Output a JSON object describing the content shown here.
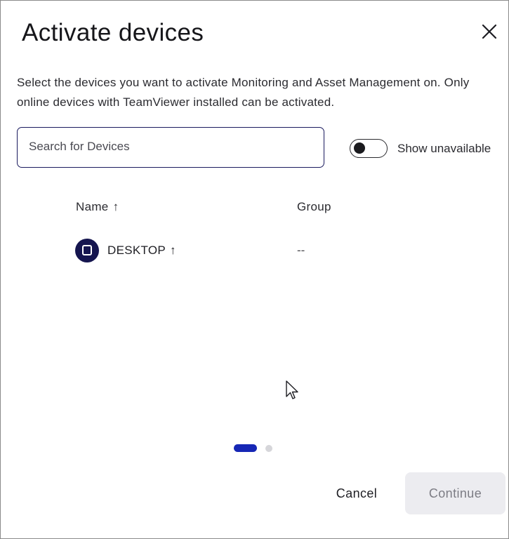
{
  "dialog": {
    "title": "Activate devices",
    "description": "Select the devices you want to activate Monitoring and Asset Management on. Only online devices with TeamViewer installed can be activated.",
    "close_icon": "close-icon"
  },
  "search": {
    "placeholder": "Search for Devices",
    "value": ""
  },
  "filter": {
    "toggle_label": "Show unavailable",
    "toggle_on": false
  },
  "table": {
    "columns": [
      {
        "label": "Name",
        "sort_icon": "arrow-up-icon",
        "sort_glyph": "↑"
      },
      {
        "label": "Group"
      }
    ],
    "rows": [
      {
        "icon": "desktop-icon",
        "name": "DESKTOP",
        "name_suffix": "↑",
        "group": "--"
      }
    ]
  },
  "pagination": {
    "pages": 2,
    "current": 1
  },
  "footer": {
    "cancel_label": "Cancel",
    "continue_label": "Continue",
    "continue_enabled": false
  },
  "colors": {
    "accent": "#1627b5",
    "icon_bg": "#15154f",
    "disabled_bg": "#ececf0"
  }
}
